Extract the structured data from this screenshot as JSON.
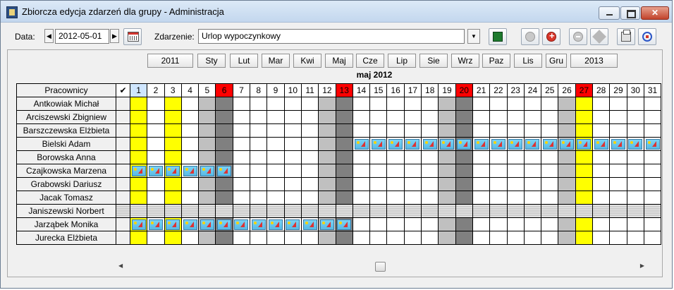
{
  "window": {
    "title": "Zbiorcza edycja zdarzeń dla grupy  - Administracja"
  },
  "toolbar": {
    "date_label": "Data:",
    "date_value": "2012-05-01",
    "event_label": "Zdarzenie:",
    "event_value": "Urlop wypoczynkowy",
    "prev_arrow": "◀",
    "next_arrow": "▶",
    "dropdown_arrow": "▼"
  },
  "nav": {
    "prev_year": "2011",
    "months": [
      "Sty",
      "Lut",
      "Mar",
      "Kwi",
      "Maj",
      "Cze",
      "Lip",
      "Sie",
      "Wrz",
      "Paz",
      "Lis",
      "Gru"
    ],
    "next_year": "2013"
  },
  "calendar": {
    "month_title": "maj 2012",
    "header_employees": "Pracownicy",
    "header_check": "✔",
    "days": 31,
    "saturdays": [
      5,
      12,
      19,
      26
    ],
    "sundays": [
      6,
      13,
      20,
      27
    ],
    "holidays": [
      1,
      3,
      27
    ],
    "today": 1,
    "employees": [
      {
        "name": "Antkowiak Michał",
        "events": [],
        "striped": false
      },
      {
        "name": "Arciszewski Zbigniew",
        "events": [],
        "striped": false
      },
      {
        "name": "Barszczewska Elżbieta",
        "events": [],
        "striped": false
      },
      {
        "name": "Bielski Adam",
        "events": [
          14,
          15,
          16,
          17,
          18,
          19,
          20,
          21,
          22,
          23,
          24,
          25,
          26,
          27,
          28,
          29,
          30,
          31
        ],
        "striped": false
      },
      {
        "name": "Borowska Anna",
        "events": [],
        "striped": false
      },
      {
        "name": "Czajkowska Marzena",
        "events": [
          1,
          2,
          3,
          4,
          5,
          6
        ],
        "striped": false
      },
      {
        "name": "Grabowski Dariusz",
        "events": [],
        "striped": false
      },
      {
        "name": "Jacak Tomasz",
        "events": [],
        "striped": false
      },
      {
        "name": "Janiszewski Norbert",
        "events": [],
        "striped": true
      },
      {
        "name": "Jarząbek Monika",
        "events": [
          1,
          2,
          3,
          4,
          5,
          6,
          7,
          8,
          9,
          10,
          11,
          12,
          13
        ],
        "striped": false
      },
      {
        "name": "Jurecka Elżbieta",
        "events": [],
        "striped": false
      }
    ]
  },
  "scrollbar": {
    "left_arrow": "◀",
    "right_arrow": "▶"
  }
}
